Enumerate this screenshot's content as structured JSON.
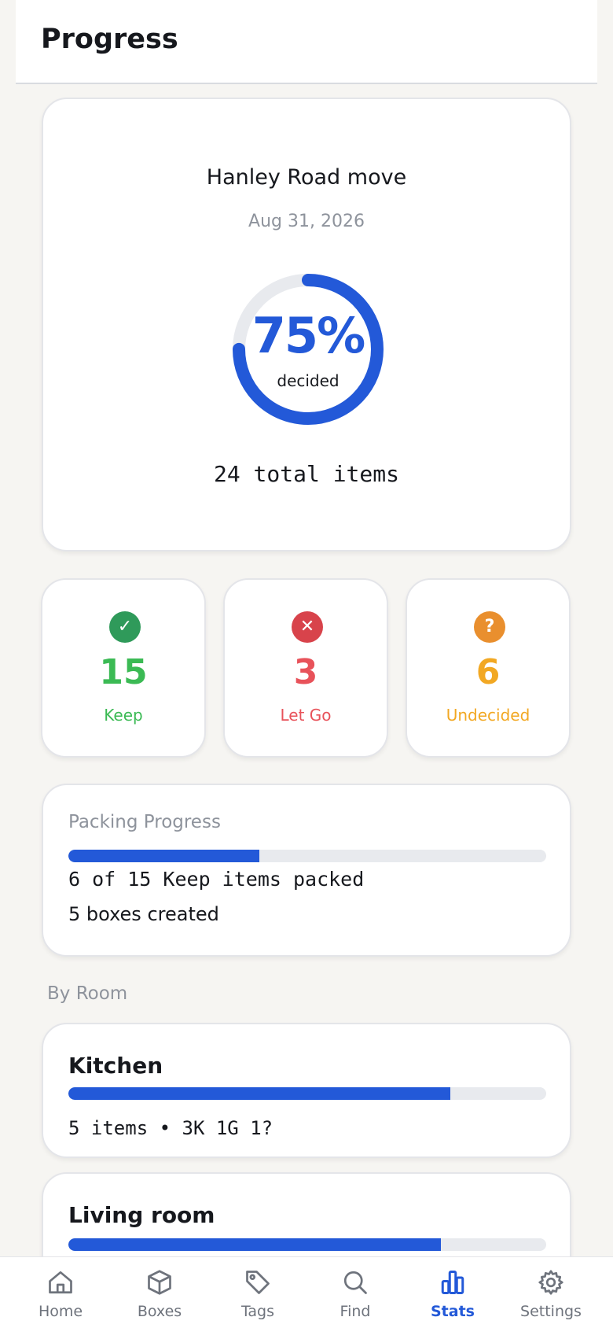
{
  "header": {
    "title": "Progress"
  },
  "summary": {
    "project_name": "Hanley Road move",
    "date": "Aug 31, 2026",
    "percent_label": "75%",
    "percent_value": 0.75,
    "percent_caption": "decided",
    "total_items": "24 total items"
  },
  "stats": [
    {
      "count": "15",
      "label": "Keep",
      "icon": "check-icon",
      "color": "#3bba54",
      "badge_color": "#2f9a5a"
    },
    {
      "count": "3",
      "label": "Let Go",
      "icon": "x-icon",
      "color": "#e8525a",
      "badge_color": "#d8434b"
    },
    {
      "count": "6",
      "label": "Undecided",
      "icon": "question-icon",
      "color": "#f2a823",
      "badge_color": "#e98f2e"
    }
  ],
  "packing": {
    "title": "Packing Progress",
    "progress_value": 0.4,
    "packed_text": "6 of 15 Keep items packed",
    "boxes_text": "5 boxes created"
  },
  "by_room": {
    "label": "By Room",
    "rooms": [
      {
        "name": "Kitchen",
        "progress_value": 0.8,
        "meta": "5 items • 3K 1G 1?"
      },
      {
        "name": "Living room",
        "progress_value": 0.78
      }
    ]
  },
  "tabbar": {
    "active": "Stats",
    "tabs": [
      {
        "label": "Home",
        "icon": "home-icon"
      },
      {
        "label": "Boxes",
        "icon": "box-icon"
      },
      {
        "label": "Tags",
        "icon": "tag-icon"
      },
      {
        "label": "Find",
        "icon": "search-icon"
      },
      {
        "label": "Stats",
        "icon": "bar-chart-icon"
      },
      {
        "label": "Settings",
        "icon": "gear-icon"
      }
    ]
  },
  "colors": {
    "accent": "#2359d8",
    "track": "#e8eaee",
    "background": "#f6f5f2"
  }
}
